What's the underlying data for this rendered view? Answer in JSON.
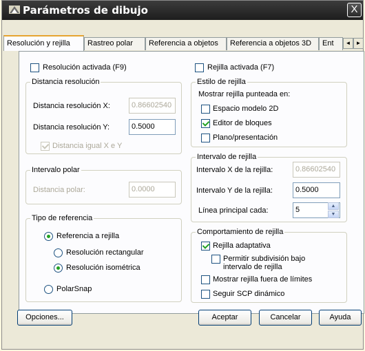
{
  "window": {
    "title": "Parámetros de dibujo",
    "close_label": "X"
  },
  "tabs": [
    {
      "label": "Resolución y rejilla"
    },
    {
      "label": "Rastreo polar"
    },
    {
      "label": "Referencia a objetos"
    },
    {
      "label": "Referencia a objetos 3D"
    },
    {
      "label": "Ent"
    }
  ],
  "tab_scroll": {
    "left": "◄",
    "right": "►"
  },
  "snap": {
    "enabled_label": "Resolución activada (F9)",
    "enabled": false,
    "spacing_group": "Distancia resolución",
    "x_label": "Distancia resolución X:",
    "x_value": "0.86602540",
    "y_label": "Distancia resolución Y:",
    "y_value": "0.5000",
    "equal_label": "Distancia igual X e Y",
    "equal_checked": true,
    "polar_group": "Intervalo polar",
    "polar_label": "Distancia polar:",
    "polar_value": "0.0000",
    "type_group": "Tipo de referencia",
    "type_grid": "Referencia a rejilla",
    "type_rect": "Resolución rectangular",
    "type_iso": "Resolución isométrica",
    "type_polar": "PolarSnap"
  },
  "grid": {
    "enabled_label": "Rejilla activada (F7)",
    "enabled": false,
    "style_group": "Estilo de rejilla",
    "style_desc": "Mostrar rejilla punteada en:",
    "style_2d": "Espacio modelo 2D",
    "style_block": "Editor de bloques",
    "style_layout": "Plano/presentación",
    "spacing_group": "Intervalo de rejilla",
    "x_label": "Intervalo X de la rejilla:",
    "x_value": "0.86602540",
    "y_label": "Intervalo Y de la rejilla:",
    "y_value": "0.5000",
    "major_label": "Línea principal cada:",
    "major_value": "5",
    "behavior_group": "Comportamiento de rejilla",
    "adaptive": "Rejilla adaptativa",
    "subdivision": "Permitir subdivisión bajo intervalo de rejilla",
    "beyond_limits": "Mostrar rejilla fuera de límites",
    "follow_ucs": "Seguir SCP dinámico"
  },
  "buttons": {
    "options": "Opciones...",
    "ok": "Aceptar",
    "cancel": "Cancelar",
    "help": "Ayuda"
  }
}
